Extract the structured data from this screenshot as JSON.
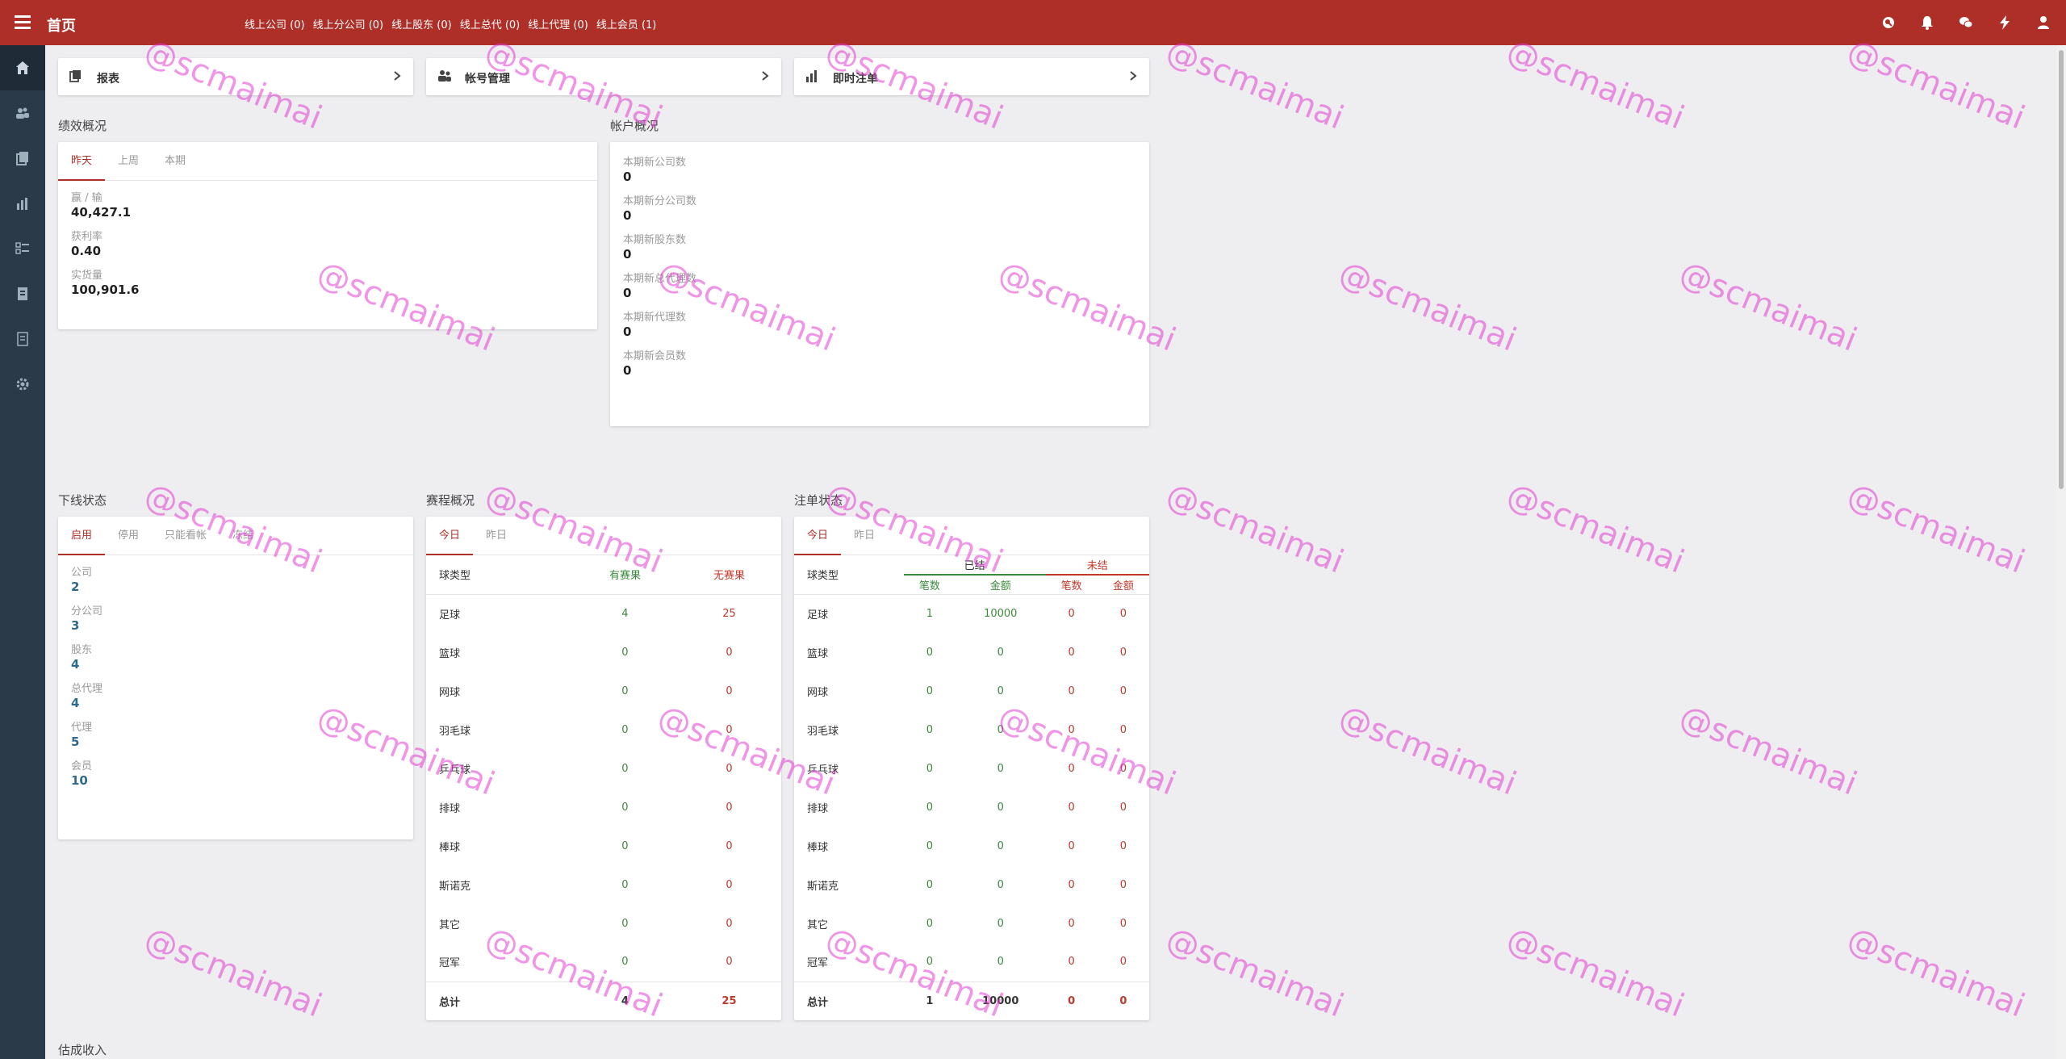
{
  "header": {
    "title": "首页",
    "online_stats": [
      "线上公司 (0)",
      "线上分公司 (0)",
      "线上股东 (0)",
      "线上总代 (0)",
      "线上代理 (0)",
      "线上会员 (1)"
    ],
    "icons": [
      "search-icon",
      "bell-icon",
      "chat-icon",
      "lightning-icon",
      "user-icon"
    ],
    "accent_color": "#ad2f28"
  },
  "sidebar": {
    "items": [
      "home-icon",
      "accounts-icon",
      "reports-icon",
      "chart-icon",
      "list-icon",
      "document-icon",
      "notes-icon",
      "settings-icon"
    ]
  },
  "quick_links": [
    {
      "label": "报表",
      "icon": "report-icon"
    },
    {
      "label": "帐号管理",
      "icon": "accounts-icon"
    },
    {
      "label": "即时注单",
      "icon": "bar-chart-icon"
    }
  ],
  "performance": {
    "title": "绩效概况",
    "tabs": [
      "昨天",
      "上周",
      "本期"
    ],
    "metrics": [
      {
        "label": "赢 / 输",
        "value": "40,427.1"
      },
      {
        "label": "获利率",
        "value": "0.40"
      },
      {
        "label": "实货量",
        "value": "100,901.6"
      }
    ]
  },
  "accounts": {
    "title": "帐户概况",
    "metrics": [
      {
        "label": "本期新公司数",
        "value": "0"
      },
      {
        "label": "本期新分公司数",
        "value": "0"
      },
      {
        "label": "本期新股东数",
        "value": "0"
      },
      {
        "label": "本期新总代理数",
        "value": "0"
      },
      {
        "label": "本期新代理数",
        "value": "0"
      },
      {
        "label": "本期新会员数",
        "value": "0"
      }
    ]
  },
  "downline": {
    "title": "下线状态",
    "tabs": [
      "启用",
      "停用",
      "只能看帐",
      "冻结"
    ],
    "metrics": [
      {
        "label": "公司",
        "value": "2"
      },
      {
        "label": "分公司",
        "value": "3"
      },
      {
        "label": "股东",
        "value": "4"
      },
      {
        "label": "总代理",
        "value": "4"
      },
      {
        "label": "代理",
        "value": "5"
      },
      {
        "label": "会员",
        "value": "10"
      }
    ]
  },
  "events": {
    "title": "赛程概况",
    "tabs": [
      "今日",
      "昨日"
    ],
    "headers": [
      "球类型",
      "有赛果",
      "无赛果"
    ],
    "rows": [
      [
        "足球",
        "4",
        "25"
      ],
      [
        "篮球",
        "0",
        "0"
      ],
      [
        "网球",
        "0",
        "0"
      ],
      [
        "羽毛球",
        "0",
        "0"
      ],
      [
        "乒乓球",
        "0",
        "0"
      ],
      [
        "排球",
        "0",
        "0"
      ],
      [
        "棒球",
        "0",
        "0"
      ],
      [
        "斯诺克",
        "0",
        "0"
      ],
      [
        "其它",
        "0",
        "0"
      ],
      [
        "冠军",
        "0",
        "0"
      ]
    ],
    "total": [
      "总计",
      "4",
      "25"
    ]
  },
  "bets": {
    "title": "注单状态",
    "tabs": [
      "今日",
      "昨日"
    ],
    "headers": {
      "type": "球类型",
      "settled": "已结",
      "unsettled": "未结",
      "count": "笔数",
      "amount": "金额"
    },
    "rows": [
      [
        "足球",
        "1",
        "10000",
        "0",
        "0"
      ],
      [
        "篮球",
        "0",
        "0",
        "0",
        "0"
      ],
      [
        "网球",
        "0",
        "0",
        "0",
        "0"
      ],
      [
        "羽毛球",
        "0",
        "0",
        "0",
        "0"
      ],
      [
        "乒乓球",
        "0",
        "0",
        "0",
        "0"
      ],
      [
        "排球",
        "0",
        "0",
        "0",
        "0"
      ],
      [
        "棒球",
        "0",
        "0",
        "0",
        "0"
      ],
      [
        "斯诺克",
        "0",
        "0",
        "0",
        "0"
      ],
      [
        "其它",
        "0",
        "0",
        "0",
        "0"
      ],
      [
        "冠军",
        "0",
        "0",
        "0",
        "0"
      ]
    ],
    "total": [
      "总计",
      "1",
      "10000",
      "0",
      "0"
    ]
  },
  "estimated_income": {
    "title": "估成收入"
  },
  "watermark": "@scmaimai"
}
